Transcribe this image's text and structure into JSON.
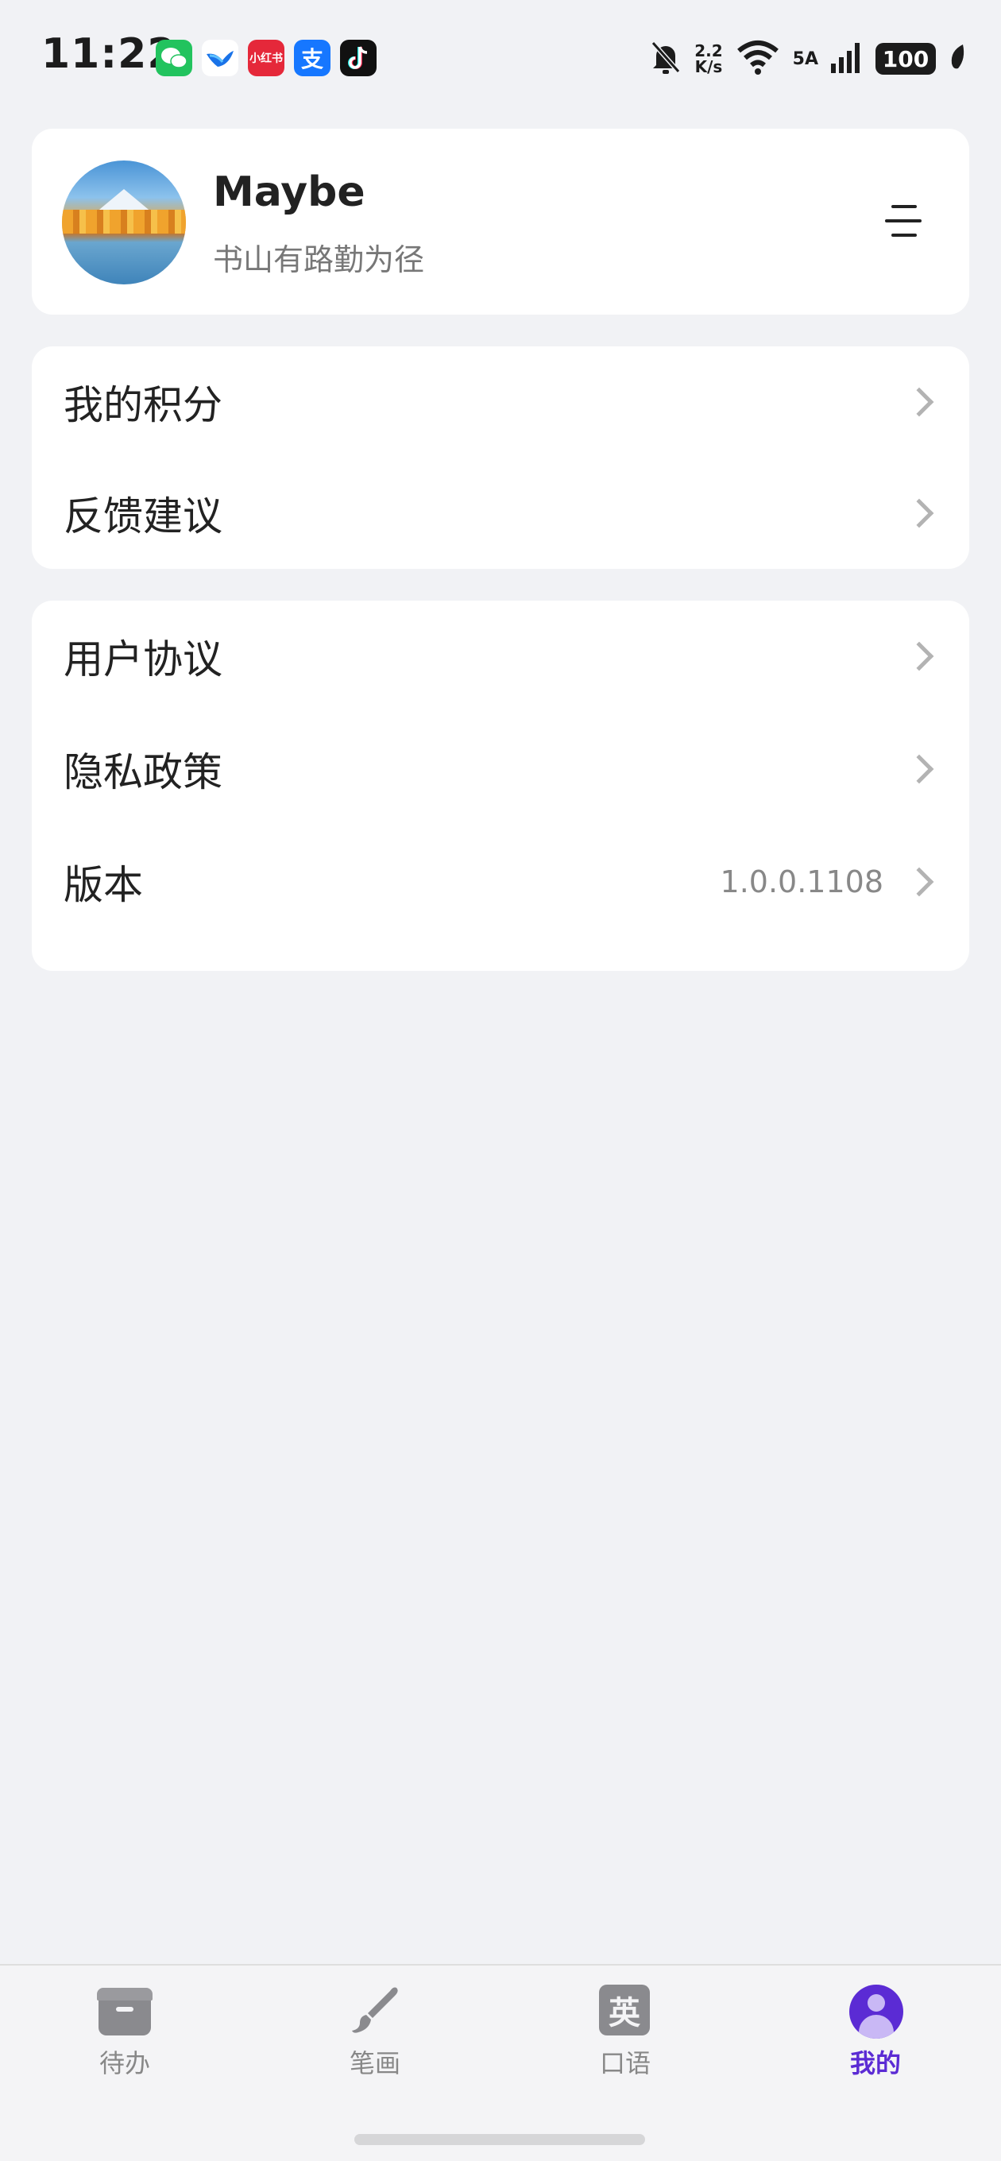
{
  "status_bar": {
    "time": "11:22",
    "net_speed_value": "2.2",
    "net_speed_unit": "K/s",
    "network": "5A",
    "battery": "100",
    "apps": [
      "wechat-icon",
      "bird-icon",
      "xiaohongshu-icon",
      "alipay-icon",
      "tiktok-icon"
    ]
  },
  "profile": {
    "name": "Maybe",
    "motto": "书山有路勤为径"
  },
  "menu_group_1": [
    {
      "label": "我的积分"
    },
    {
      "label": "反馈建议"
    }
  ],
  "menu_group_2": [
    {
      "label": "用户协议",
      "value": ""
    },
    {
      "label": "隐私政策",
      "value": ""
    },
    {
      "label": "版本",
      "value": "1.0.0.1108"
    }
  ],
  "bottom_nav": {
    "items": [
      {
        "label": "待办",
        "icon": "todo-box-icon"
      },
      {
        "label": "笔画",
        "icon": "brush-icon"
      },
      {
        "label": "口语",
        "icon": "english-char-icon",
        "glyph": "英"
      },
      {
        "label": "我的",
        "icon": "user-icon",
        "active": true
      }
    ]
  },
  "colors": {
    "accent": "#5b2bd4",
    "background": "#f1f2f5",
    "card": "#ffffff"
  }
}
